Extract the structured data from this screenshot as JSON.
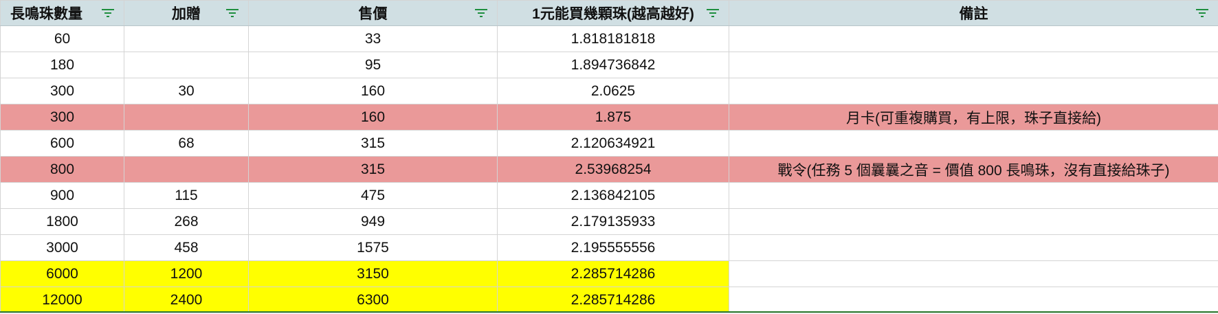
{
  "sheet": {
    "headers": [
      "長鳴珠數量",
      "加贈",
      "售價",
      "1元能買幾顆珠(越高越好)",
      "備註"
    ],
    "rows": [
      {
        "cells": [
          "60",
          "",
          "33",
          "1.818181818",
          ""
        ],
        "highlight": "none"
      },
      {
        "cells": [
          "180",
          "",
          "95",
          "1.894736842",
          ""
        ],
        "highlight": "none"
      },
      {
        "cells": [
          "300",
          "30",
          "160",
          "2.0625",
          ""
        ],
        "highlight": "none"
      },
      {
        "cells": [
          "300",
          "",
          "160",
          "1.875",
          "月卡(可重複購買，有上限，珠子直接給)"
        ],
        "highlight": "pink"
      },
      {
        "cells": [
          "600",
          "68",
          "315",
          "2.120634921",
          ""
        ],
        "highlight": "none"
      },
      {
        "cells": [
          "800",
          "",
          "315",
          "2.53968254",
          "戰令(任務 5 個曩曩之音 = 價值 800 長鳴珠，沒有直接給珠子)"
        ],
        "highlight": "pink"
      },
      {
        "cells": [
          "900",
          "115",
          "475",
          "2.136842105",
          ""
        ],
        "highlight": "none"
      },
      {
        "cells": [
          "1800",
          "268",
          "949",
          "2.179135933",
          ""
        ],
        "highlight": "none"
      },
      {
        "cells": [
          "3000",
          "458",
          "1575",
          "2.195555556",
          ""
        ],
        "highlight": "none"
      },
      {
        "cells": [
          "6000",
          "1200",
          "3150",
          "2.285714286",
          ""
        ],
        "highlight": "yellow"
      },
      {
        "cells": [
          "12000",
          "2400",
          "6300",
          "2.285714286",
          ""
        ],
        "highlight": "yellow"
      }
    ]
  },
  "colors": {
    "header_bg": "#d0dfe3",
    "pink_row": "#ea9999",
    "yellow_cell": "#ffff00",
    "filter_icon": "#1e8e3e",
    "grid_line": "#d4d4d4"
  },
  "icons": {
    "filter": "filter-icon"
  }
}
